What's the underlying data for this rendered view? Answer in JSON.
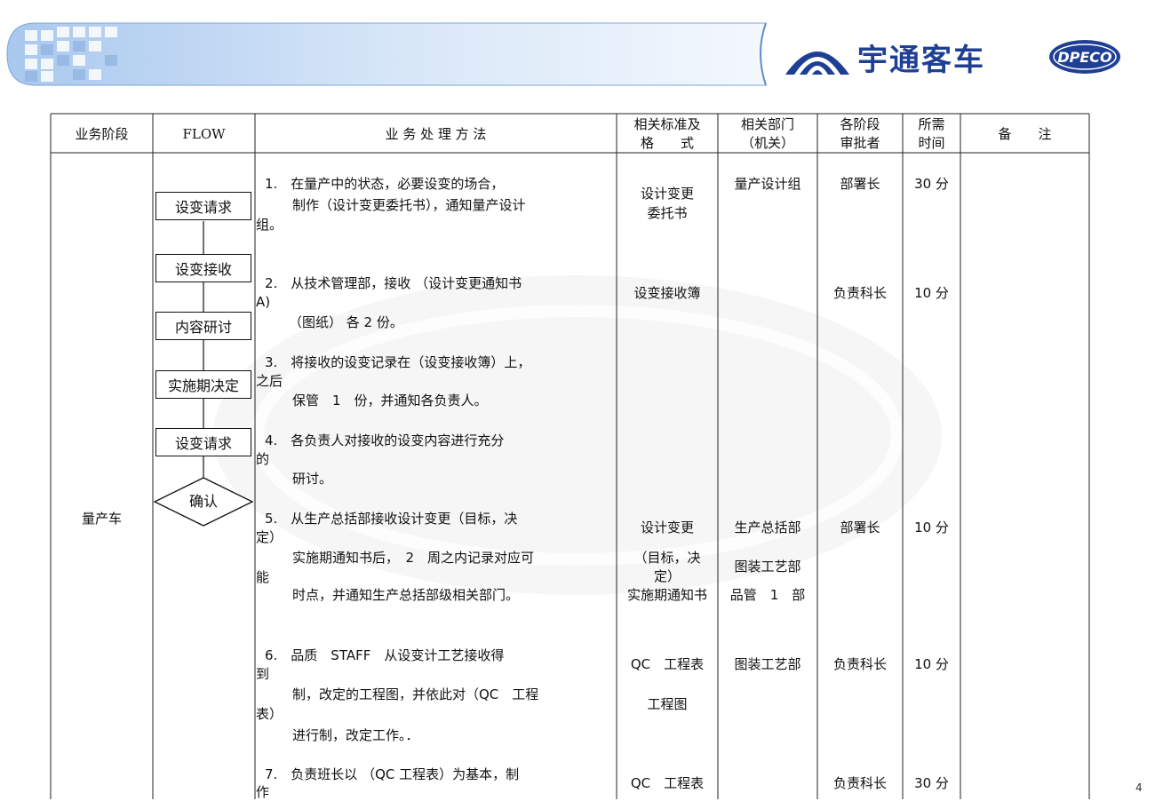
{
  "brand": {
    "name_cn": "宇通客车",
    "logo_text": "DPECO"
  },
  "table": {
    "headers": {
      "stage": "业务阶段",
      "flow": "FLOW",
      "method": "业 务 处 理 方 法",
      "standard_1": "相关标准及",
      "standard_2": "格　　式",
      "dept_1": "相关部门",
      "dept_2": "（机关）",
      "approver_1": "各阶段",
      "approver_2": "审批者",
      "time_1": "所需",
      "time_2": "时间",
      "remark": "备　　注"
    },
    "stage": "量产车",
    "flow": [
      "设变请求",
      "设变接收",
      "内容研讨",
      "实施期决定",
      "设变请求",
      "确认"
    ],
    "steps": [
      {
        "lines": [
          "1.　在量产中的状态，必要设变的场合，",
          "制作（设计变更委托书），通知量产设计",
          "组。"
        ],
        "standard": [
          "设计变更",
          "委托书"
        ],
        "dept": [
          "量产设计组"
        ],
        "approver": "部署长",
        "time": "30 分"
      },
      {
        "lines": [
          "2.　从技术管理部，接收 （设计变更通知书",
          "A)",
          "（图纸） 各 2 份。"
        ],
        "standard": [
          "设变接收簿"
        ],
        "dept": [],
        "approver": "负责科长",
        "time": "10 分"
      },
      {
        "lines": [
          "3.　将接收的设变记录在（设变接收簿）上，",
          "之后",
          "保管　1　份，并通知各负责人。"
        ],
        "standard": [],
        "dept": [],
        "approver": "",
        "time": ""
      },
      {
        "lines": [
          "4.　各负责人对接收的设变内容进行充分",
          "的",
          "研讨。"
        ],
        "standard": [],
        "dept": [],
        "approver": "",
        "time": ""
      },
      {
        "lines": [
          "5.　从生产总括部接收设计变更（目标，决",
          "定）",
          "实施期通知书后，　2　周之内记录对应可",
          "能",
          "时点，并通知生产总括部级相关部门。"
        ],
        "standard": [
          "设计变更",
          "（目标，决",
          "定）",
          "实施期通知书"
        ],
        "dept": [
          "生产总括部",
          "图装工艺部",
          "品管　1　部"
        ],
        "approver": "部署长",
        "time": "10 分"
      },
      {
        "lines": [
          "6.　品质　STAFF　从设变计工艺接收得",
          "到",
          "制，改定的工程图，并依此对（QC　工程",
          "表）",
          "进行制，改定工作。．"
        ],
        "standard": [
          "QC　工程表",
          "工程图"
        ],
        "dept": [
          "图装工艺部"
        ],
        "approver": "负责科长",
        "time": "10 分"
      },
      {
        "lines": [
          "7.　负责班长以 （QC 工程表）为基本，制",
          "作"
        ],
        "standard": [
          "QC　工程表"
        ],
        "dept": [],
        "approver": "负责科长",
        "time": "30 分"
      }
    ]
  },
  "page_number": "4"
}
